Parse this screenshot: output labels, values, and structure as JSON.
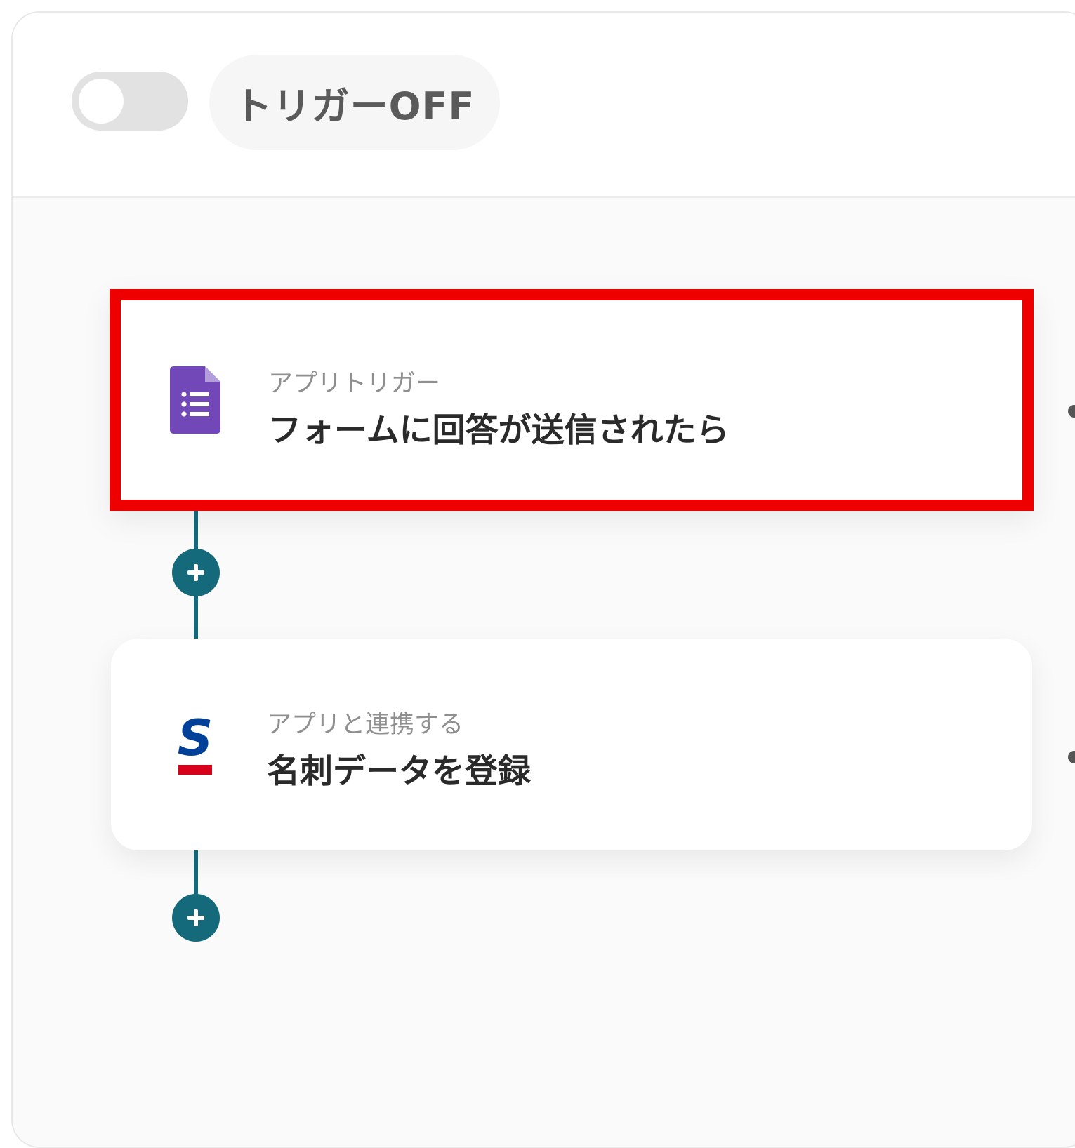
{
  "header": {
    "toggle_state": "off",
    "status_label": "トリガーOFF"
  },
  "flow": {
    "steps": [
      {
        "kind": "trigger",
        "subtitle": "アプリトリガー",
        "title": "フォームに回答が送信されたら",
        "icon": "google-forms-icon",
        "highlighted": true,
        "highlight_color": "#EE0000"
      },
      {
        "kind": "action",
        "subtitle": "アプリと連携する",
        "title": "名刺データを登録",
        "icon": "sansan-logo-icon",
        "highlighted": false
      }
    ]
  },
  "colors": {
    "connector": "#14697A",
    "forms_purple": "#7248B9",
    "sansan_blue": "#004098",
    "sansan_red": "#D7001D"
  }
}
